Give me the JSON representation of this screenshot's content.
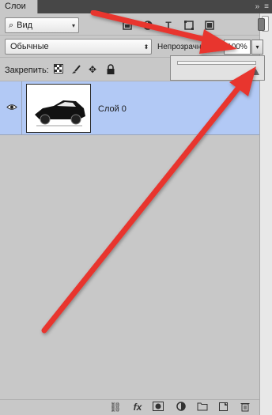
{
  "panel": {
    "tab_label": "Слои",
    "topbar_icons": "»",
    "menu_icon": "≡"
  },
  "filter": {
    "label": "Вид",
    "icons": [
      "image-filter-icon",
      "adjustment-filter-icon",
      "type-filter-icon",
      "shape-filter-icon",
      "smart-object-filter-icon"
    ]
  },
  "blend_mode": {
    "value": "Обычные"
  },
  "opacity": {
    "label": "Непрозрачность:",
    "value": "100%",
    "slider_value": 1.0
  },
  "lock": {
    "label": "Закрепить:",
    "icons": [
      "lock-transparent-icon",
      "lock-paint-icon",
      "lock-move-icon",
      "lock-all-icon"
    ]
  },
  "layers": [
    {
      "name": "Слой 0",
      "visible": true,
      "thumbnail": "black convertible car"
    }
  ],
  "bottom_icons": [
    "link-icon",
    "fx-icon",
    "mask-icon",
    "adjustment-icon",
    "group-icon",
    "new-layer-icon",
    "trash-icon"
  ],
  "colors": {
    "accent_arrow": "#e8342f",
    "selected_layer": "#b2c9f5"
  }
}
